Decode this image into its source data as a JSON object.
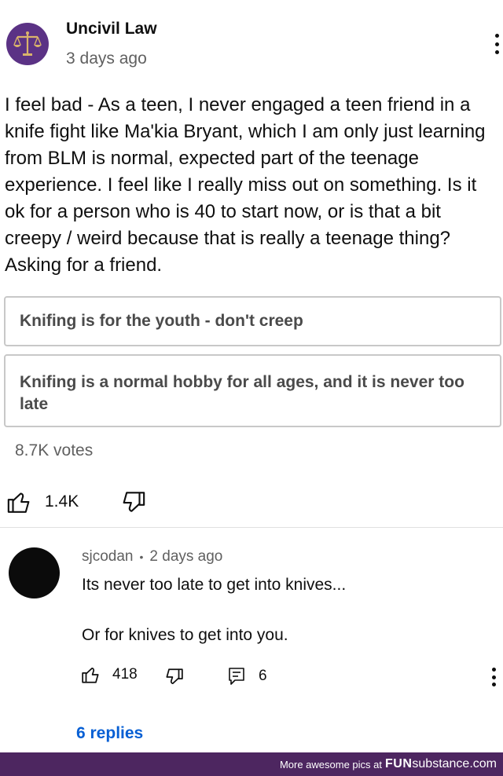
{
  "post": {
    "channel_name": "Uncivil Law",
    "time": "3 days ago",
    "text": "I feel bad - As a teen, I never engaged a teen friend in a knife fight like Ma'kia Bryant, which I am only just learning from BLM is normal, expected part of the teenage experience. I feel like I really miss out on something. Is it ok for a person who is 40 to start now, or is that a bit creepy / weird because that is really a teenage thing? Asking for a friend.",
    "poll": {
      "options": [
        "Knifing is for the youth - don't creep",
        "Knifing is a normal hobby for all ages, and it is never too late"
      ],
      "votes": "8.7K votes"
    },
    "likes": "1.4K"
  },
  "comment": {
    "author": "sjcodan",
    "separator": "•",
    "time": "2 days ago",
    "lines": [
      "Its never too late to get into knives...",
      "Or for knives to get into you."
    ],
    "likes": "418",
    "reply_count": "6",
    "replies_link": "6 replies"
  },
  "footer": {
    "prefix": "More awesome pics at",
    "brand_bold": "FUN",
    "brand_rest": "substance.com"
  },
  "colors": {
    "footer_bg": "#4d2660",
    "avatar_bg": "#5b3285",
    "avatar_gold": "#d9b36b",
    "link_blue": "#065fd4"
  },
  "icons": {
    "channel_avatar": "scales-of-justice-icon",
    "like": "thumbs-up-icon",
    "dislike": "thumbs-down-icon",
    "reply": "comment-icon",
    "menu": "more-vert-icon"
  }
}
